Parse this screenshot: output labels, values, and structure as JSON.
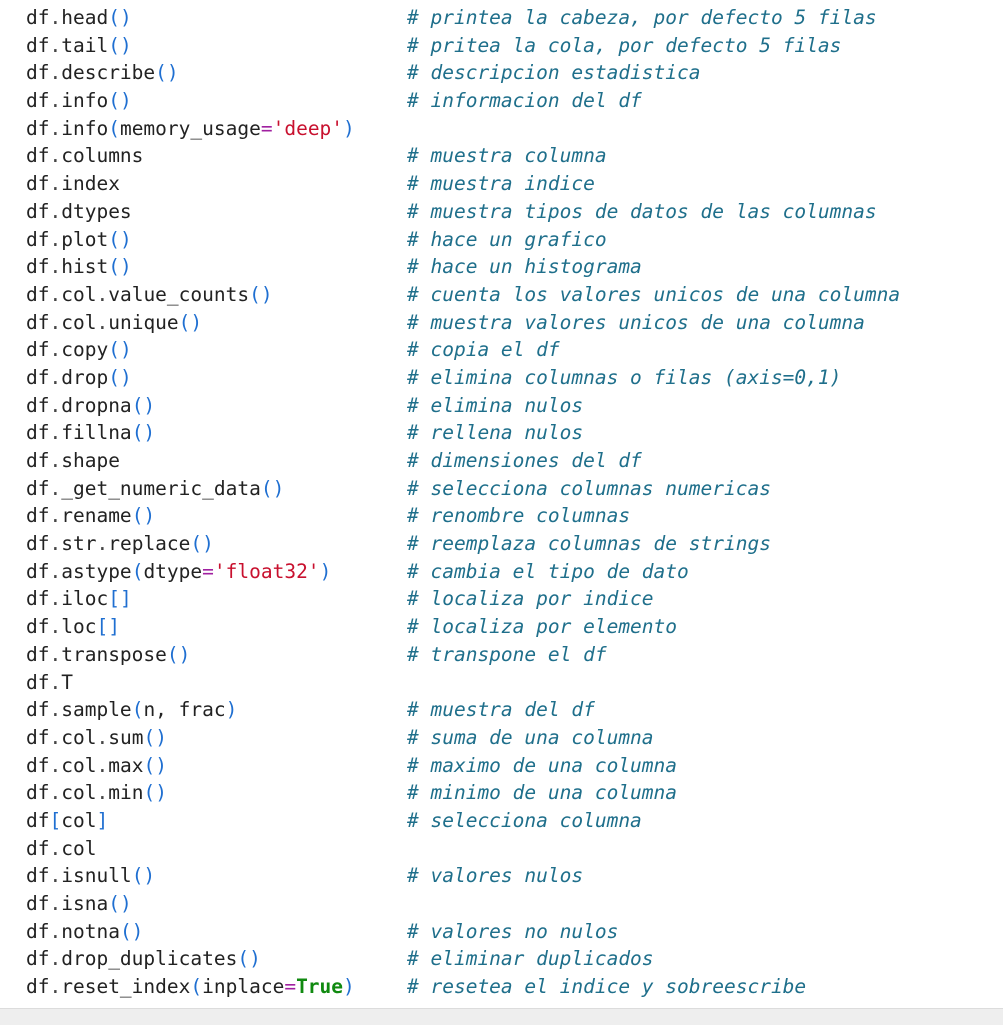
{
  "editor": {
    "lines": [
      {
        "code": [
          [
            "obj",
            "df"
          ],
          [
            "dot",
            "."
          ],
          [
            "fn",
            "head"
          ],
          [
            "paren",
            "()"
          ]
        ],
        "comment": "# printea la cabeza, por defecto 5 filas"
      },
      {
        "code": [
          [
            "obj",
            "df"
          ],
          [
            "dot",
            "."
          ],
          [
            "fn",
            "tail"
          ],
          [
            "paren",
            "()"
          ]
        ],
        "comment": "# pritea la cola, por defecto 5 filas"
      },
      {
        "code": [
          [
            "obj",
            "df"
          ],
          [
            "dot",
            "."
          ],
          [
            "fn",
            "describe"
          ],
          [
            "paren",
            "()"
          ]
        ],
        "comment": "# descripcion estadistica"
      },
      {
        "code": [
          [
            "obj",
            "df"
          ],
          [
            "dot",
            "."
          ],
          [
            "fn",
            "info"
          ],
          [
            "paren",
            "()"
          ]
        ],
        "comment": "# informacion del df"
      },
      {
        "code": [
          [
            "obj",
            "df"
          ],
          [
            "dot",
            "."
          ],
          [
            "fn",
            "info"
          ],
          [
            "paren",
            "("
          ],
          [
            "fn",
            "memory_usage"
          ],
          [
            "op",
            "="
          ],
          [
            "str",
            "'deep'"
          ],
          [
            "paren",
            ")"
          ]
        ],
        "comment": ""
      },
      {
        "code": [
          [
            "obj",
            "df"
          ],
          [
            "dot",
            "."
          ],
          [
            "fn",
            "columns"
          ]
        ],
        "comment": "# muestra columna"
      },
      {
        "code": [
          [
            "obj",
            "df"
          ],
          [
            "dot",
            "."
          ],
          [
            "fn",
            "index"
          ]
        ],
        "comment": "# muestra indice"
      },
      {
        "code": [
          [
            "obj",
            "df"
          ],
          [
            "dot",
            "."
          ],
          [
            "fn",
            "dtypes"
          ]
        ],
        "comment": "# muestra tipos de datos de las columnas"
      },
      {
        "code": [
          [
            "obj",
            "df"
          ],
          [
            "dot",
            "."
          ],
          [
            "fn",
            "plot"
          ],
          [
            "paren",
            "()"
          ]
        ],
        "comment": "# hace un grafico"
      },
      {
        "code": [
          [
            "obj",
            "df"
          ],
          [
            "dot",
            "."
          ],
          [
            "fn",
            "hist"
          ],
          [
            "paren",
            "()"
          ]
        ],
        "comment": "# hace un histograma"
      },
      {
        "code": [
          [
            "obj",
            "df"
          ],
          [
            "dot",
            "."
          ],
          [
            "fn",
            "col"
          ],
          [
            "dot",
            "."
          ],
          [
            "fn",
            "value_counts"
          ],
          [
            "paren",
            "()"
          ]
        ],
        "comment": "# cuenta los valores unicos de una columna"
      },
      {
        "code": [
          [
            "obj",
            "df"
          ],
          [
            "dot",
            "."
          ],
          [
            "fn",
            "col"
          ],
          [
            "dot",
            "."
          ],
          [
            "fn",
            "unique"
          ],
          [
            "paren",
            "()"
          ]
        ],
        "comment": "# muestra valores unicos de una columna"
      },
      {
        "code": [
          [
            "obj",
            "df"
          ],
          [
            "dot",
            "."
          ],
          [
            "fn",
            "copy"
          ],
          [
            "paren",
            "()"
          ]
        ],
        "comment": "# copia el df"
      },
      {
        "code": [
          [
            "obj",
            "df"
          ],
          [
            "dot",
            "."
          ],
          [
            "fn",
            "drop"
          ],
          [
            "paren",
            "()"
          ]
        ],
        "comment": "# elimina columnas o filas (axis=0,1)"
      },
      {
        "code": [
          [
            "obj",
            "df"
          ],
          [
            "dot",
            "."
          ],
          [
            "fn",
            "dropna"
          ],
          [
            "paren",
            "()"
          ]
        ],
        "comment": "# elimina nulos"
      },
      {
        "code": [
          [
            "obj",
            "df"
          ],
          [
            "dot",
            "."
          ],
          [
            "fn",
            "fillna"
          ],
          [
            "paren",
            "()"
          ]
        ],
        "comment": "# rellena nulos"
      },
      {
        "code": [
          [
            "obj",
            "df"
          ],
          [
            "dot",
            "."
          ],
          [
            "fn",
            "shape"
          ]
        ],
        "comment": "# dimensiones del df"
      },
      {
        "code": [
          [
            "obj",
            "df"
          ],
          [
            "dot",
            "."
          ],
          [
            "fn",
            "_get_numeric_data"
          ],
          [
            "paren",
            "()"
          ]
        ],
        "comment": "# selecciona columnas numericas"
      },
      {
        "code": [
          [
            "obj",
            "df"
          ],
          [
            "dot",
            "."
          ],
          [
            "fn",
            "rename"
          ],
          [
            "paren",
            "()"
          ]
        ],
        "comment": "# renombre columnas"
      },
      {
        "code": [
          [
            "obj",
            "df"
          ],
          [
            "dot",
            "."
          ],
          [
            "fn",
            "str"
          ],
          [
            "dot",
            "."
          ],
          [
            "fn",
            "replace"
          ],
          [
            "paren",
            "()"
          ]
        ],
        "comment": "# reemplaza columnas de strings"
      },
      {
        "code": [
          [
            "obj",
            "df"
          ],
          [
            "dot",
            "."
          ],
          [
            "fn",
            "astype"
          ],
          [
            "paren",
            "("
          ],
          [
            "fn",
            "dtype"
          ],
          [
            "op",
            "="
          ],
          [
            "str",
            "'float32'"
          ],
          [
            "paren",
            ")"
          ]
        ],
        "comment": "# cambia el tipo de dato"
      },
      {
        "code": [
          [
            "obj",
            "df"
          ],
          [
            "dot",
            "."
          ],
          [
            "fn",
            "iloc"
          ],
          [
            "paren",
            "[]"
          ]
        ],
        "comment": "# localiza por indice"
      },
      {
        "code": [
          [
            "obj",
            "df"
          ],
          [
            "dot",
            "."
          ],
          [
            "fn",
            "loc"
          ],
          [
            "paren",
            "[]"
          ]
        ],
        "comment": "# localiza por elemento"
      },
      {
        "code": [
          [
            "obj",
            "df"
          ],
          [
            "dot",
            "."
          ],
          [
            "fn",
            "transpose"
          ],
          [
            "paren",
            "()"
          ]
        ],
        "comment": "# transpone el df"
      },
      {
        "code": [
          [
            "obj",
            "df"
          ],
          [
            "dot",
            "."
          ],
          [
            "fn",
            "T"
          ]
        ],
        "comment": ""
      },
      {
        "code": [
          [
            "obj",
            "df"
          ],
          [
            "dot",
            "."
          ],
          [
            "fn",
            "sample"
          ],
          [
            "paren",
            "("
          ],
          [
            "fn",
            "n, frac"
          ],
          [
            "paren",
            ")"
          ]
        ],
        "comment": "# muestra del df"
      },
      {
        "code": [
          [
            "obj",
            "df"
          ],
          [
            "dot",
            "."
          ],
          [
            "fn",
            "col"
          ],
          [
            "dot",
            "."
          ],
          [
            "fn",
            "sum"
          ],
          [
            "paren",
            "()"
          ]
        ],
        "comment": "# suma de una columna"
      },
      {
        "code": [
          [
            "obj",
            "df"
          ],
          [
            "dot",
            "."
          ],
          [
            "fn",
            "col"
          ],
          [
            "dot",
            "."
          ],
          [
            "fn",
            "max"
          ],
          [
            "paren",
            "()"
          ]
        ],
        "comment": "# maximo de una columna"
      },
      {
        "code": [
          [
            "obj",
            "df"
          ],
          [
            "dot",
            "."
          ],
          [
            "fn",
            "col"
          ],
          [
            "dot",
            "."
          ],
          [
            "fn",
            "min"
          ],
          [
            "paren",
            "()"
          ]
        ],
        "comment": "# minimo de una columna"
      },
      {
        "code": [
          [
            "obj",
            "df"
          ],
          [
            "paren",
            "["
          ],
          [
            "fn",
            "col"
          ],
          [
            "paren",
            "]"
          ]
        ],
        "comment": "# selecciona columna"
      },
      {
        "code": [
          [
            "obj",
            "df"
          ],
          [
            "dot",
            "."
          ],
          [
            "fn",
            "col"
          ]
        ],
        "comment": ""
      },
      {
        "code": [
          [
            "obj",
            "df"
          ],
          [
            "dot",
            "."
          ],
          [
            "fn",
            "isnull"
          ],
          [
            "paren",
            "()"
          ]
        ],
        "comment": "# valores nulos"
      },
      {
        "code": [
          [
            "obj",
            "df"
          ],
          [
            "dot",
            "."
          ],
          [
            "fn",
            "isna"
          ],
          [
            "paren",
            "()"
          ]
        ],
        "comment": ""
      },
      {
        "code": [
          [
            "obj",
            "df"
          ],
          [
            "dot",
            "."
          ],
          [
            "fn",
            "notna"
          ],
          [
            "paren",
            "()"
          ]
        ],
        "comment": "# valores no nulos"
      },
      {
        "code": [
          [
            "obj",
            "df"
          ],
          [
            "dot",
            "."
          ],
          [
            "fn",
            "drop_duplicates"
          ],
          [
            "paren",
            "()"
          ]
        ],
        "comment": "# eliminar duplicados"
      },
      {
        "code": [
          [
            "obj",
            "df"
          ],
          [
            "dot",
            "."
          ],
          [
            "fn",
            "reset_index"
          ],
          [
            "paren",
            "("
          ],
          [
            "fn",
            "inplace"
          ],
          [
            "op",
            "="
          ],
          [
            "kw",
            "True"
          ],
          [
            "paren",
            ")"
          ]
        ],
        "comment": "# resetea el indice y sobreescribe"
      }
    ]
  }
}
